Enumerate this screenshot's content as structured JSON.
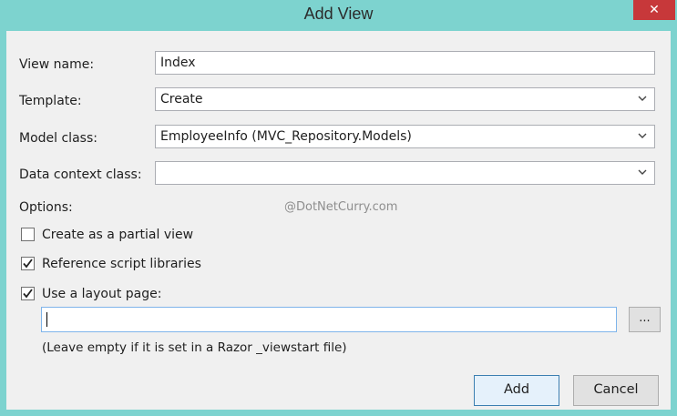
{
  "window": {
    "title": "Add View",
    "close_glyph": "✕"
  },
  "form": {
    "view_name": {
      "label": "View name:",
      "value": "Index"
    },
    "template": {
      "label": "Template:",
      "value": "Create"
    },
    "model_class": {
      "label": "Model class:",
      "value": "EmployeeInfo (MVC_Repository.Models)"
    },
    "data_context_class": {
      "label": "Data context class:",
      "value": ""
    }
  },
  "options": {
    "heading": "Options:",
    "partial_view": {
      "label": "Create as a partial view",
      "checked": false
    },
    "reference_scripts": {
      "label": "Reference script libraries",
      "checked": true
    },
    "use_layout": {
      "label": "Use a layout page:",
      "checked": true
    },
    "layout_path": {
      "value": ""
    },
    "browse_label": "...",
    "hint": "(Leave empty if it is set in a Razor _viewstart file)"
  },
  "watermark": "@DotNetCurry.com",
  "buttons": {
    "add": "Add",
    "cancel": "Cancel"
  }
}
